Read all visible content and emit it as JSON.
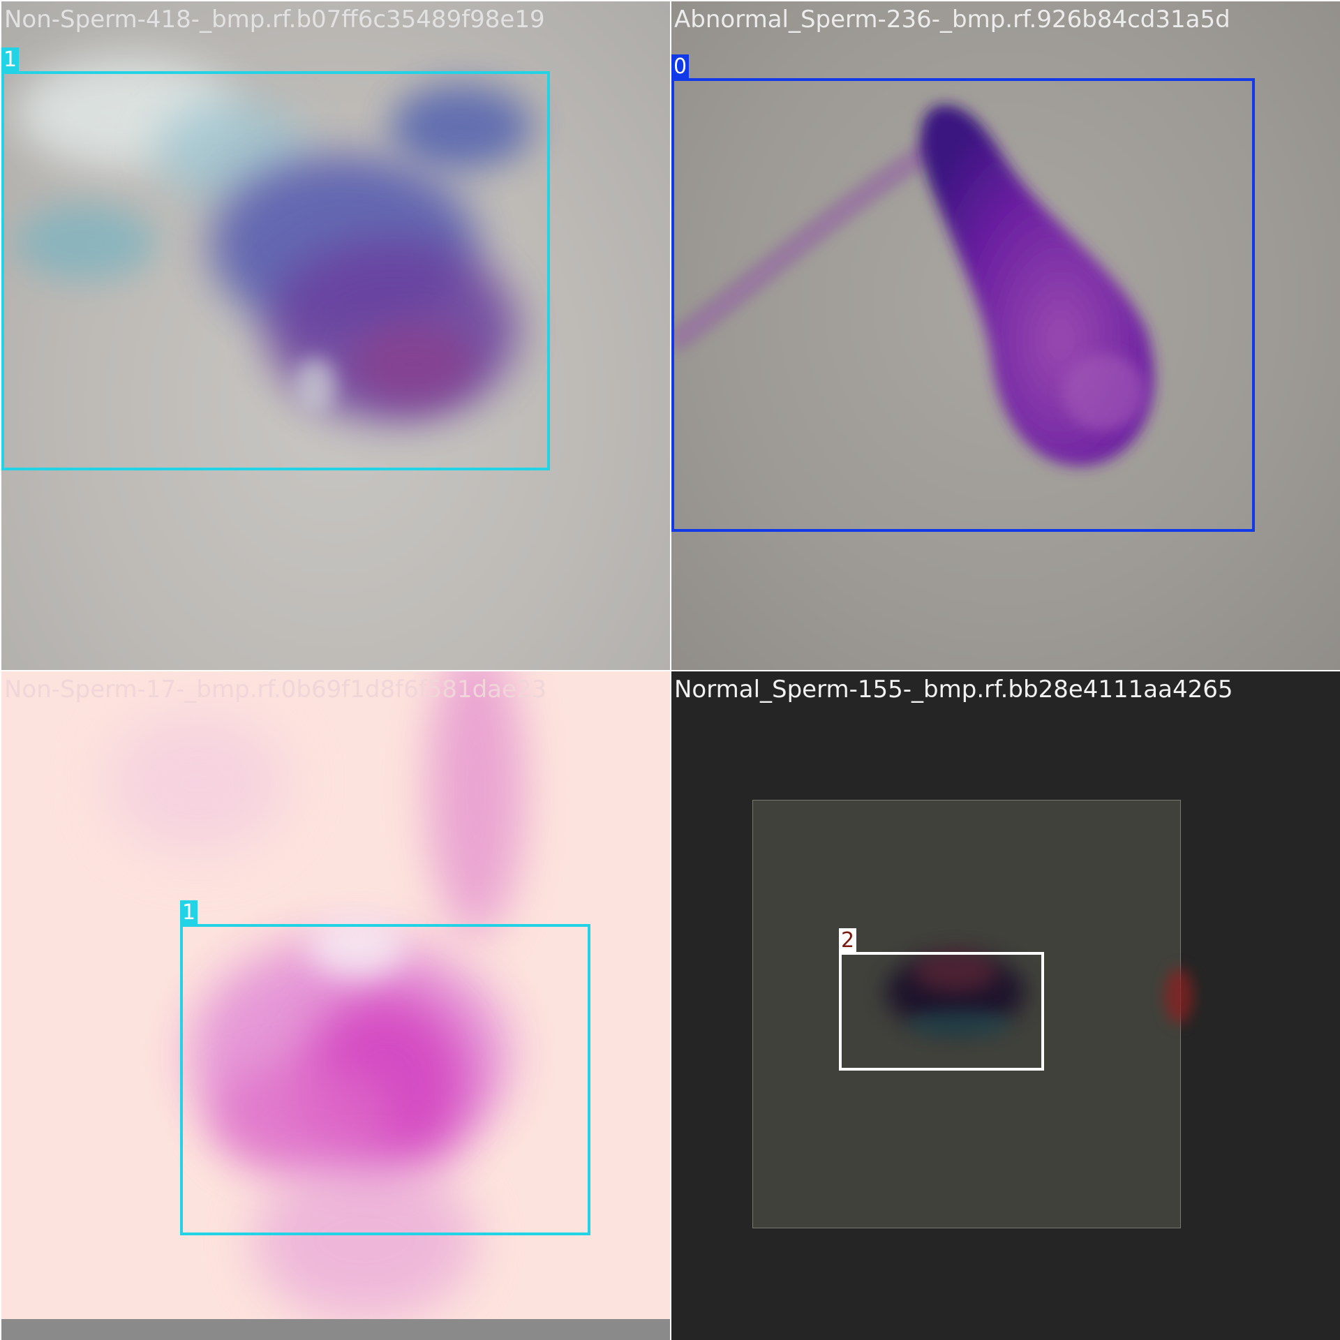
{
  "tiles": [
    {
      "caption": "Non-Sperm-418-_bmp.rf.b07ff6c35489f98e19",
      "caption_color": "#e2e2e2",
      "label": "1",
      "box_color": "#22d3e6",
      "label_text_color": "#ffffff"
    },
    {
      "caption": "Abnormal_Sperm-236-_bmp.rf.926b84cd31a5d",
      "caption_color": "#ececec",
      "label": "0",
      "box_color": "#1239e8",
      "label_text_color": "#ffffff"
    },
    {
      "caption": "Non-Sperm-17-_bmp.rf.0b69f1d8f6f581dae23",
      "caption_color": "#f0d6d8",
      "label": "1",
      "box_color": "#22d3e6",
      "label_text_color": "#ffffff"
    },
    {
      "caption": "Normal_Sperm-155-_bmp.rf.bb28e4111aa4265",
      "caption_color": "#f2f2f2",
      "label": "2",
      "box_color": "#ffffff",
      "label_text_color": "#7a1a0c"
    }
  ]
}
